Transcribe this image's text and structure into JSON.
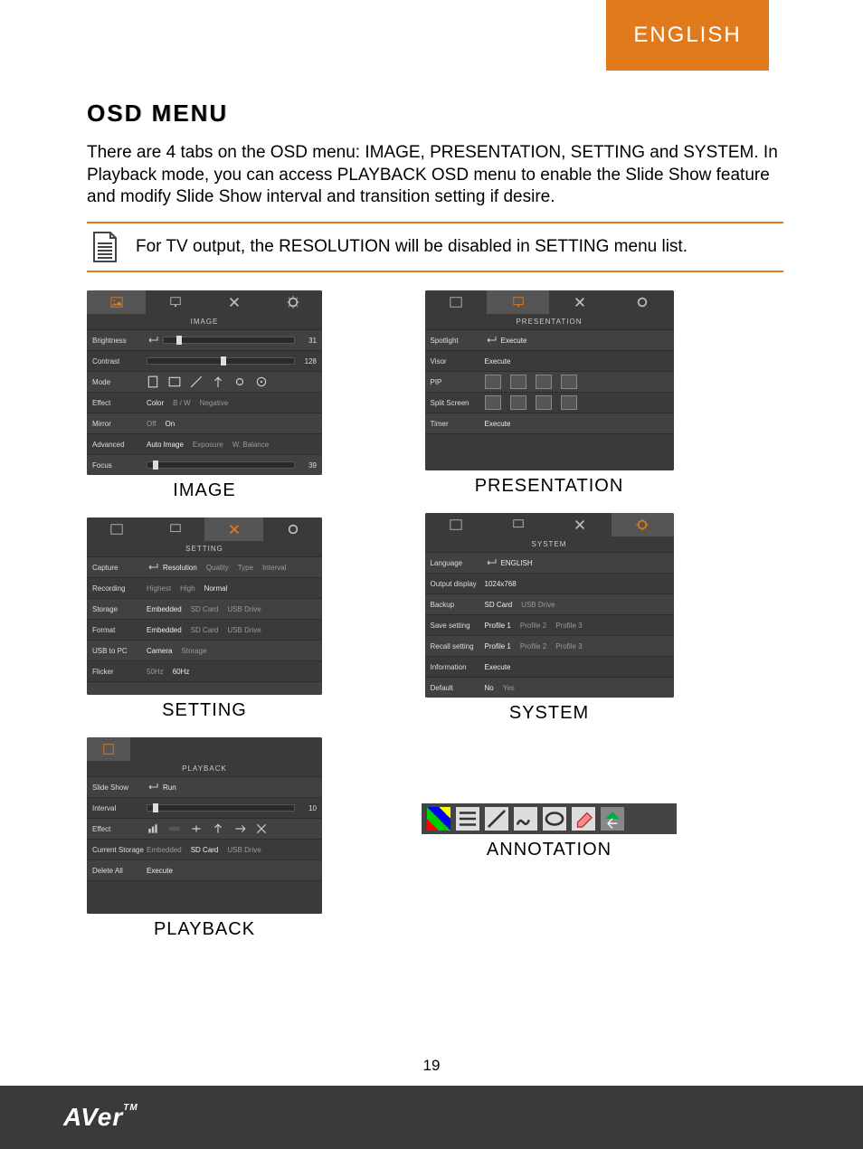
{
  "lang": "ENGLISH",
  "heading": "OSD MENU",
  "intro": "There are 4 tabs on the OSD menu: IMAGE, PRESENTATION, SETTING and SYSTEM. In Playback mode, you can access PLAYBACK OSD menu to enable the Slide Show feature and modify Slide Show interval and transition setting if desire.",
  "note": "For TV output, the RESOLUTION will be disabled in SETTING menu list.",
  "captions": {
    "image": "IMAGE",
    "setting": "SETTING",
    "playback": "PLAYBACK",
    "presentation": "PRESENTATION",
    "system": "SYSTEM",
    "annotation": "ANNOTATION"
  },
  "panels": {
    "image": {
      "sub": "IMAGE",
      "items": [
        {
          "label": "Brightness",
          "value": "31"
        },
        {
          "label": "Contrast",
          "value": "128"
        },
        {
          "label": "Mode"
        },
        {
          "label": "Effect",
          "values": [
            "Color",
            "B / W",
            "Negative"
          ]
        },
        {
          "label": "Mirror",
          "values": [
            "Off",
            "On"
          ]
        },
        {
          "label": "Advanced",
          "values": [
            "Auto Image",
            "Exposure",
            "W. Balance"
          ]
        },
        {
          "label": "Focus",
          "value": "39"
        }
      ]
    },
    "presentation": {
      "sub": "PRESENTATION",
      "items": [
        {
          "label": "Spotlight",
          "values": [
            "Execute"
          ]
        },
        {
          "label": "Visor",
          "values": [
            "Execute"
          ]
        },
        {
          "label": "PIP"
        },
        {
          "label": "Split Screen"
        },
        {
          "label": "Timer",
          "values": [
            "Execute"
          ]
        }
      ]
    },
    "setting": {
      "sub": "SETTING",
      "items": [
        {
          "label": "Capture",
          "values": [
            "Resolution",
            "Quality",
            "Type",
            "Interval"
          ]
        },
        {
          "label": "Recording",
          "values": [
            "Highest",
            "High",
            "Normal"
          ]
        },
        {
          "label": "Storage",
          "values": [
            "Embedded",
            "SD Card",
            "USB Drive"
          ]
        },
        {
          "label": "Format",
          "values": [
            "Embedded",
            "SD Card",
            "USB Drive"
          ]
        },
        {
          "label": "USB to PC",
          "values": [
            "Camera",
            "Storage"
          ]
        },
        {
          "label": "Flicker",
          "values": [
            "50Hz",
            "60Hz"
          ]
        }
      ]
    },
    "system": {
      "sub": "SYSTEM",
      "items": [
        {
          "label": "Language",
          "values": [
            "ENGLISH"
          ]
        },
        {
          "label": "Output display",
          "values": [
            "1024x768"
          ]
        },
        {
          "label": "Backup",
          "values": [
            "SD Card",
            "USB Drive"
          ]
        },
        {
          "label": "Save setting",
          "values": [
            "Profile 1",
            "Profile 2",
            "Profile 3"
          ]
        },
        {
          "label": "Recall setting",
          "values": [
            "Profile 1",
            "Profile 2",
            "Profile 3"
          ]
        },
        {
          "label": "Information",
          "values": [
            "Execute"
          ]
        },
        {
          "label": "Default",
          "values": [
            "No",
            "Yes"
          ]
        }
      ]
    },
    "playback": {
      "sub": "PLAYBACK",
      "items": [
        {
          "label": "Slide Show",
          "values": [
            "Run"
          ]
        },
        {
          "label": "Interval",
          "value": "10"
        },
        {
          "label": "Effect"
        },
        {
          "label": "Current Storage",
          "values": [
            "Embedded",
            "SD Card",
            "USB Drive"
          ]
        },
        {
          "label": "Delete All",
          "values": [
            "Execute"
          ]
        }
      ]
    }
  },
  "page": "19",
  "brand": "AVer",
  "tm": "TM"
}
